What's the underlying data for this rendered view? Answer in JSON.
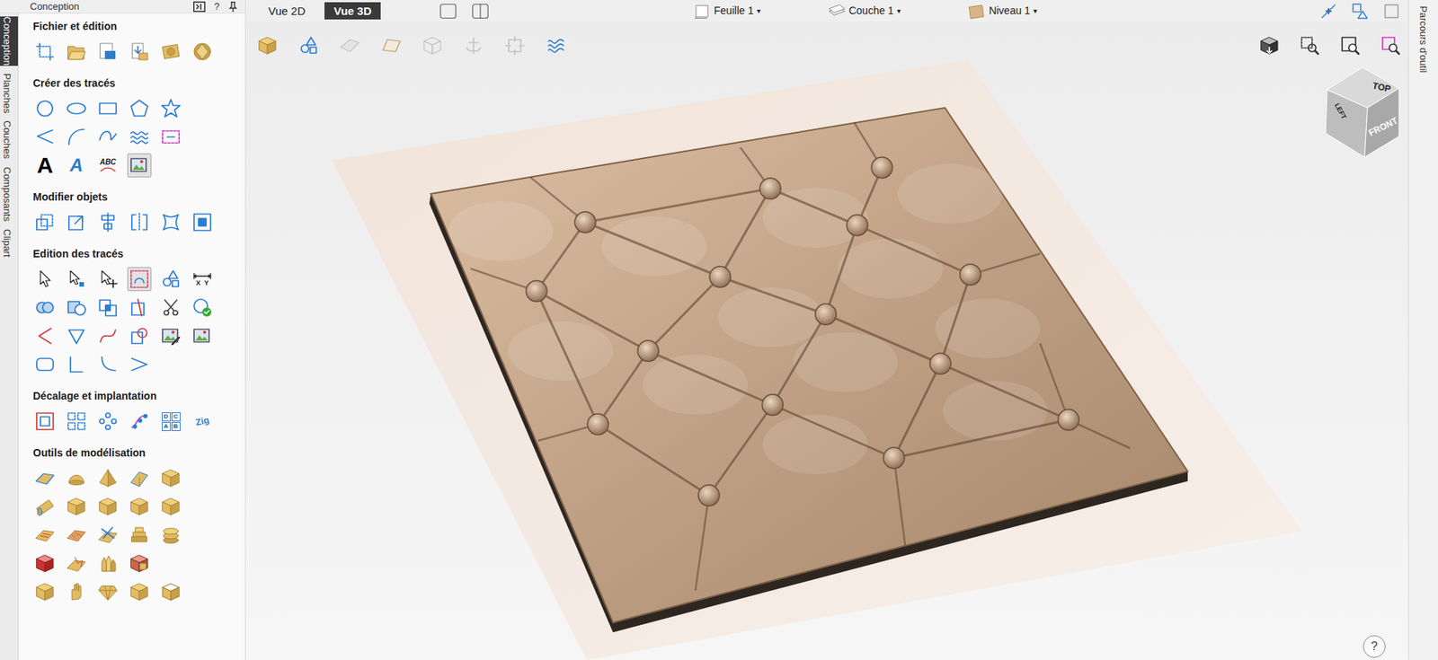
{
  "panel": {
    "title": "Conception",
    "help": "?"
  },
  "side_tabs": [
    {
      "label": "Conception",
      "selected": true
    },
    {
      "label": "Planches",
      "selected": false
    },
    {
      "label": "Couches",
      "selected": false
    },
    {
      "label": "Composants",
      "selected": false
    },
    {
      "label": "Clipart",
      "selected": false
    }
  ],
  "sections": [
    {
      "title": "Fichier et édition",
      "rows": [
        [
          {
            "kind": "job-setup",
            "selected": false
          },
          {
            "kind": "open",
            "selected": false
          },
          {
            "kind": "save",
            "selected": false
          },
          {
            "kind": "import",
            "selected": false
          },
          {
            "kind": "clipart",
            "selected": false
          },
          {
            "kind": "gem",
            "selected": false
          }
        ]
      ]
    },
    {
      "title": "Créer des tracés",
      "rows": [
        [
          {
            "kind": "circle",
            "selected": false
          },
          {
            "kind": "ellipse",
            "selected": false
          },
          {
            "kind": "rect",
            "selected": false
          },
          {
            "kind": "polygon",
            "selected": false
          },
          {
            "kind": "star",
            "selected": false
          }
        ],
        [
          {
            "kind": "polyline",
            "selected": false
          },
          {
            "kind": "arc",
            "selected": false
          },
          {
            "kind": "curve",
            "selected": false
          },
          {
            "kind": "wave",
            "selected": false
          },
          {
            "kind": "dash-rect",
            "selected": false
          }
        ],
        [
          {
            "kind": "text-a",
            "label": "A",
            "selected": false
          },
          {
            "kind": "text-outline",
            "label": "A",
            "selected": false
          },
          {
            "kind": "text-arc",
            "label": "ABC",
            "selected": false
          },
          {
            "kind": "image-trace",
            "selected": true
          }
        ]
      ]
    },
    {
      "title": "Modifier objets",
      "rows": [
        [
          {
            "kind": "scale",
            "selected": false
          },
          {
            "kind": "resize",
            "selected": false
          },
          {
            "kind": "align",
            "selected": false
          },
          {
            "kind": "mirror",
            "selected": false
          },
          {
            "kind": "distort",
            "selected": false
          },
          {
            "kind": "fit",
            "selected": false
          }
        ]
      ]
    },
    {
      "title": "Edition des tracés",
      "rows": [
        [
          {
            "kind": "pointer",
            "selected": false
          },
          {
            "kind": "node",
            "selected": false
          },
          {
            "kind": "move",
            "selected": false
          },
          {
            "kind": "dash-select",
            "selected": true
          },
          {
            "kind": "shapes",
            "selected": false
          },
          {
            "kind": "dims",
            "label": "X  Y",
            "selected": false
          }
        ],
        [
          {
            "kind": "weld",
            "selected": false
          },
          {
            "kind": "subtract",
            "selected": false
          },
          {
            "kind": "overlap",
            "selected": false
          },
          {
            "kind": "trim",
            "selected": false
          },
          {
            "kind": "scissors",
            "selected": false
          },
          {
            "kind": "check",
            "selected": false
          }
        ],
        [
          {
            "kind": "join",
            "selected": false
          },
          {
            "kind": "triangle",
            "selected": false
          },
          {
            "kind": "spline",
            "selected": false
          },
          {
            "kind": "fillet",
            "selected": false
          },
          {
            "kind": "image-edit",
            "selected": false
          },
          {
            "kind": "image-link",
            "selected": false
          }
        ],
        [
          {
            "kind": "round-rect",
            "selected": false
          },
          {
            "kind": "bracket",
            "selected": false
          },
          {
            "kind": "bow",
            "selected": false
          },
          {
            "kind": "chevron",
            "selected": false
          }
        ]
      ]
    },
    {
      "title": "Décalage et implantation",
      "rows": [
        [
          {
            "kind": "offset",
            "selected": false
          },
          {
            "kind": "grid",
            "selected": false
          },
          {
            "kind": "array",
            "selected": false
          },
          {
            "kind": "path-copy",
            "selected": false
          },
          {
            "kind": "letter-grid",
            "labels": [
              "D",
              "C",
              "A",
              "B"
            ],
            "selected": false
          },
          {
            "kind": "zig",
            "label": "Zig",
            "selected": false
          }
        ]
      ]
    },
    {
      "title": "Outils de modélisation",
      "rows": [
        [
          {
            "kind": "slab",
            "selected": false
          },
          {
            "kind": "dome",
            "selected": false
          },
          {
            "kind": "pyramid",
            "selected": false
          },
          {
            "kind": "wedge",
            "selected": false
          },
          {
            "kind": "block",
            "selected": false
          }
        ],
        [
          {
            "kind": "roll",
            "selected": false
          },
          {
            "kind": "bar",
            "selected": false
          },
          {
            "kind": "key",
            "selected": false
          },
          {
            "kind": "twist",
            "selected": false
          },
          {
            "kind": "sculpt",
            "selected": false
          }
        ],
        [
          {
            "kind": "hatch",
            "selected": false
          },
          {
            "kind": "texture",
            "selected": false
          },
          {
            "kind": "cutter",
            "selected": false
          },
          {
            "kind": "layer-stack",
            "selected": false
          },
          {
            "kind": "coins",
            "selected": false
          }
        ],
        [
          {
            "kind": "red-block",
            "selected": false
          },
          {
            "kind": "splash",
            "selected": false
          },
          {
            "kind": "flames",
            "selected": false
          },
          {
            "kind": "mix-block",
            "selected": false
          }
        ],
        [
          {
            "kind": "wave3d",
            "selected": false
          },
          {
            "kind": "hand",
            "selected": false
          },
          {
            "kind": "gem3d",
            "selected": false
          },
          {
            "kind": "box",
            "selected": false
          },
          {
            "kind": "box-open",
            "selected": false
          }
        ]
      ]
    }
  ],
  "view_tabs": [
    {
      "label": "Vue 2D",
      "selected": false
    },
    {
      "label": "Vue 3D",
      "selected": true
    }
  ],
  "layout_buttons": [
    {
      "kind": "single-view",
      "selected": false
    },
    {
      "kind": "split-view",
      "selected": false
    }
  ],
  "dropdowns": [
    {
      "kind": "sheet",
      "label": "Feuille 1",
      "arrow": "▾"
    },
    {
      "kind": "layer",
      "label": "Couche 1",
      "arrow": "▾"
    },
    {
      "kind": "level",
      "label": "Niveau 1",
      "arrow": "▾"
    }
  ],
  "top_tools": [
    {
      "kind": "snap-node"
    },
    {
      "kind": "snap-shape"
    },
    {
      "kind": "snap-frame"
    }
  ],
  "view_tools_left": [
    {
      "kind": "cube3d",
      "disabled": false
    },
    {
      "kind": "shapes",
      "disabled": false
    },
    {
      "kind": "tile",
      "disabled": true
    },
    {
      "kind": "plane",
      "disabled": false
    },
    {
      "kind": "wire-cube",
      "disabled": true
    },
    {
      "kind": "anchor",
      "disabled": true
    },
    {
      "kind": "frame-node",
      "disabled": true
    },
    {
      "kind": "toolpath-wave",
      "disabled": false
    }
  ],
  "view_tools_right": [
    {
      "kind": "shade-view"
    },
    {
      "kind": "zoom-box"
    },
    {
      "kind": "zoom-fit"
    },
    {
      "kind": "zoom-select"
    }
  ],
  "view_cube": {
    "top": "TOP",
    "left": "LEFT",
    "front": "FRONT"
  },
  "help_button": "?",
  "right_tab": {
    "label": "Parcours d'outil",
    "selected": false
  }
}
